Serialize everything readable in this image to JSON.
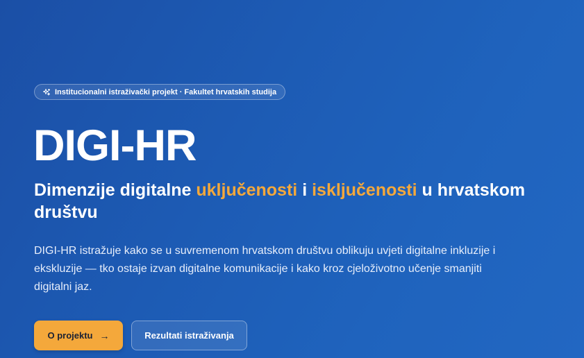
{
  "badge": {
    "icon": "sparkles-icon",
    "text": "Institucionalni istraživački projekt · Fakultet hrvatskih studija"
  },
  "hero": {
    "title": "DIGI-HR",
    "subtitle": {
      "part1": "Dimenzije digitalne ",
      "accent1": "uključenosti",
      "part2": " i ",
      "accent2": "isključenosti",
      "part3": " u hrvatskom društvu"
    },
    "description": "DIGI-HR istražuje kako se u suvremenom hrvatskom društvu oblikuju uvjeti digitalne inkluzije i ekskluzije — tko ostaje izvan digitalne komunikacije i kako kroz cjeloživotno učenje smanjiti digitalni jaz."
  },
  "actions": {
    "primary_label": "O projektu",
    "primary_icon": "arrow-right-icon",
    "primary_arrow": "→",
    "secondary_label": "Rezultati istraživanja"
  },
  "colors": {
    "background_start": "#1b4fa6",
    "background_end": "#2267c2",
    "accent": "#f4a83b",
    "text": "#ffffff"
  }
}
